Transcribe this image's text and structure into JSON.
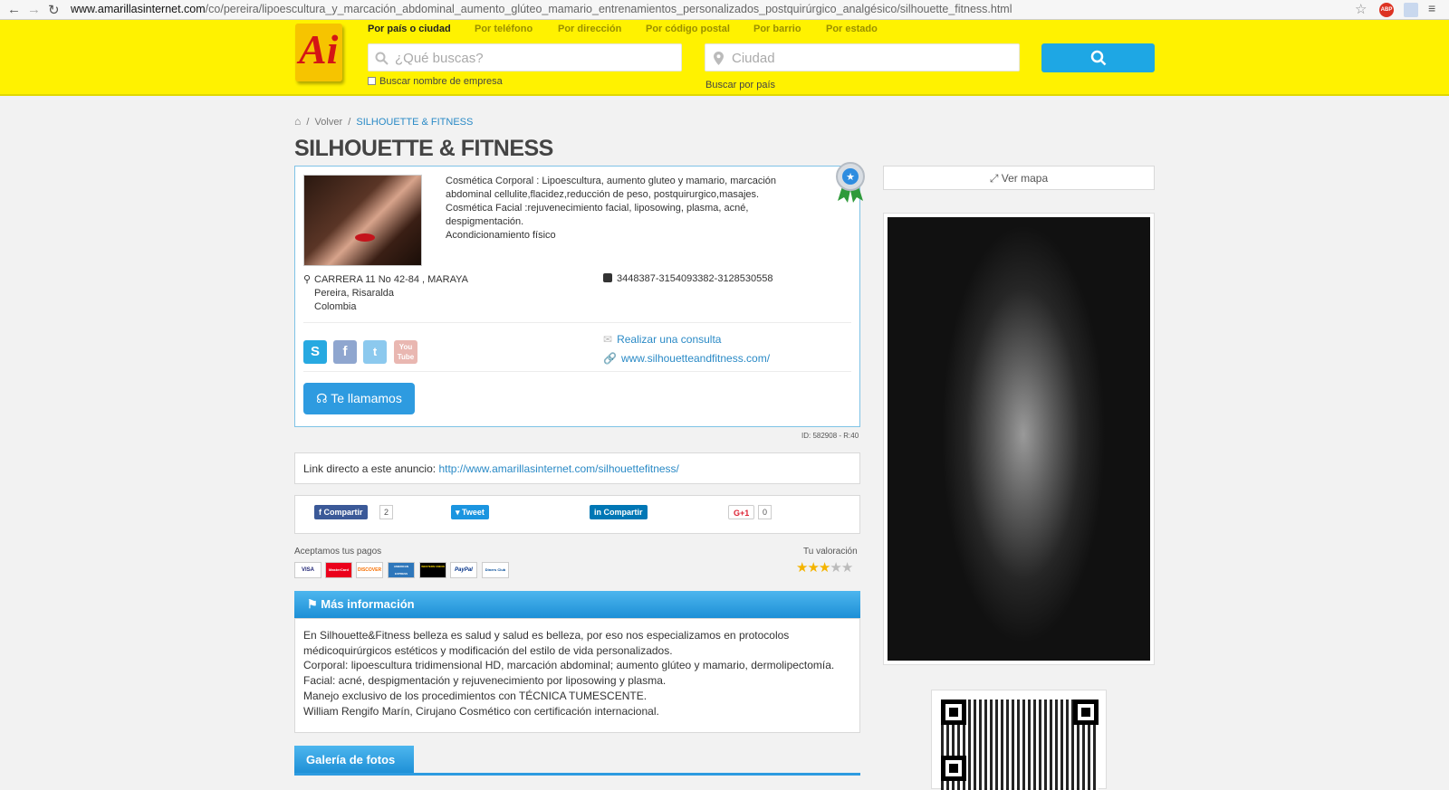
{
  "browser": {
    "url_domain": "www.amarillasinternet.com",
    "url_path": "/co/pereira/lipoescultura_y_marcación_abdominal_aumento_glúteo_mamario_entrenamientos_personalizados_postquirúrgico_analgésico/silhouette_fitness.html"
  },
  "search": {
    "tabs": [
      "Por país o ciudad",
      "Por teléfono",
      "Por dirección",
      "Por código postal",
      "Por barrio",
      "Por estado"
    ],
    "query_placeholder": "¿Qué buscas?",
    "city_placeholder": "Ciudad",
    "company_checkbox_label": "Buscar nombre de empresa",
    "country_link": "Buscar por país"
  },
  "breadcrumb": {
    "back": "Volver",
    "current": "SILHOUETTE & FITNESS"
  },
  "business": {
    "name": "SILHOUETTE & FITNESS",
    "description": [
      "Cosmética Corporal : Lipoescultura, aumento gluteo y mamario, marcación",
      "abdominal cellulite,flacidez,reducción de peso, postquirurgico,masajes.",
      "Cosmética Facial :rejuvenecimiento facial, liposowing, plasma, acné,",
      "despigmentación.",
      "Acondicionamiento físico"
    ],
    "address": [
      "CARRERA 11 No 42-84 , MARAYA",
      "Pereira, Risaralda",
      "Colombia"
    ],
    "phone": "3448387-3154093382-3128530558",
    "consult_link": "Realizar una consulta",
    "website": "www.silhouetteandfitness.com/",
    "call_button": "Te llamamos",
    "id_text": "ID: 582908 - R:40"
  },
  "direct_link": {
    "label": "Link directo a este anuncio:",
    "url": "http://www.amarillasinternet.com/silhouettefitness/"
  },
  "share": {
    "facebook_label": "Compartir",
    "facebook_count": "2",
    "twitter_label": "Tweet",
    "linkedin_label": "Compartir",
    "gplus_label": "G+1",
    "gplus_count": "0"
  },
  "payments": {
    "label": "Aceptamos tus pagos",
    "cards": [
      "VISA",
      "MasterCard",
      "DISCOVER",
      "AMERICAN EXPRESS",
      "WESTERN UNION",
      "PayPal",
      "Diners Club"
    ]
  },
  "rating": {
    "label": "Tu valoración",
    "value": 3,
    "max": 5
  },
  "more_info": {
    "title": "Más información",
    "lines": [
      "En Silhouette&Fitness belleza es salud y salud es belleza, por eso nos especializamos en protocolos",
      "médicoquirúrgicos estéticos y modificación del estilo de vida personalizados.",
      "Corporal: lipoescultura tridimensional HD, marcación abdominal; aumento glúteo y mamario, dermolipectomía.",
      "Facial: acné, despigmentación y rejuvenecimiento por liposowing y plasma.",
      "Manejo exclusivo de los procedimientos con TÉCNICA TUMESCENTE.",
      "William Rengifo Marín, Cirujano Cosmético con certificación internacional."
    ]
  },
  "gallery": {
    "title": "Galería de fotos"
  },
  "map": {
    "label": "Ver mapa"
  },
  "social_icons": [
    "skype-icon",
    "facebook-icon",
    "twitter-icon",
    "youtube-icon"
  ],
  "colors": {
    "header_yellow": "#fff200",
    "accent_blue": "#1ea7e4",
    "link_blue": "#2a8ac6"
  }
}
